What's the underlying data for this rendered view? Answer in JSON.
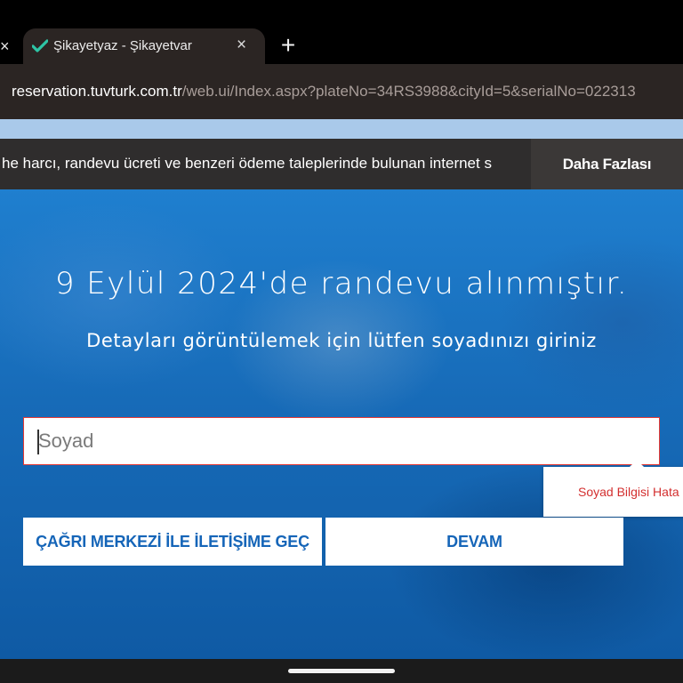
{
  "browser": {
    "prev_tab_close": "×",
    "active_tab": {
      "title": "Şikayetyaz - Şikayetvar",
      "close": "×",
      "favicon": "sikayetvar-checkmark-icon"
    },
    "new_tab": "+",
    "url": {
      "host": "reservation.tuvturk.com.tr",
      "path": "/web.ui/Index.aspx?plateNo=34RS3988&cityId=5&serialNo=022313"
    }
  },
  "announcement": {
    "text": "he harcı, randevu ücreti ve benzeri ödeme taleplerinde bulunan internet s",
    "more_label": "Daha Fazlası"
  },
  "hero": {
    "title": "9 Eylül 2024'de randevu alınmıştır.",
    "subtitle": "Detayları görüntülemek için lütfen soyadınızı giriniz"
  },
  "form": {
    "surname_placeholder": "Soyad",
    "surname_value": "",
    "error_tooltip": "Soyad Bilgisi Hata",
    "call_center_label": "ÇAĞRI MERKEZİ İLE İLETİŞİME GEÇ",
    "continue_label": "DEVAM"
  },
  "colors": {
    "accent": "#1565b8",
    "error": "#d32f2f",
    "hero_blue": "#1a72c0",
    "announcement_bg": "#2f2d2d"
  }
}
